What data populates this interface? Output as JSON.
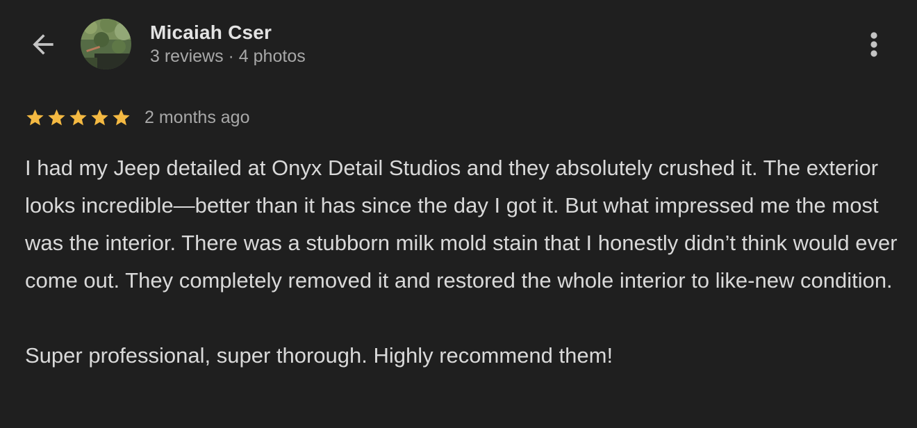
{
  "header": {
    "user_name": "Micaiah Cser",
    "user_meta": "3 reviews · 4 photos"
  },
  "review": {
    "rating": 5,
    "rating_max": 5,
    "date": "2 months ago",
    "paragraphs": [
      "I had my Jeep detailed at Onyx Detail Studios and they absolutely crushed it. The exterior looks incredible—better than it has since the day I got it. But what impressed me the most was the interior. There was a stubborn milk mold stain that I honestly didn’t think would ever come out. They completely removed it and restored the whole interior to like-new condition.",
      "Super professional, super thorough. Highly recommend them!"
    ]
  },
  "icons": {
    "back": "back-arrow-icon",
    "more": "more-vert-icon",
    "star": "star-icon"
  },
  "colors": {
    "background": "#1f1f1f",
    "star": "#f4b942",
    "primary_text": "#e3e3e3",
    "secondary_text": "#a8a8a8",
    "body_text": "#d9d9d9"
  }
}
